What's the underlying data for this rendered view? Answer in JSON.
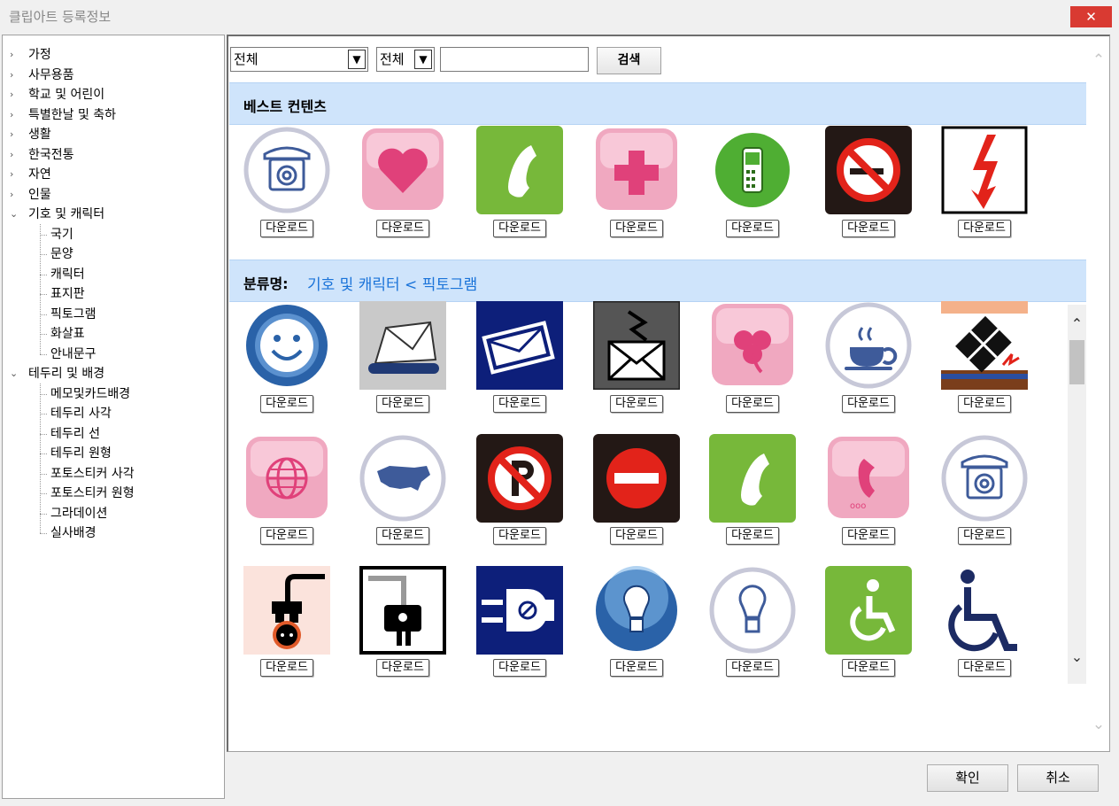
{
  "window": {
    "title": "클립아트 등록정보",
    "close_glyph": "✕"
  },
  "tree": {
    "categories": [
      {
        "label": "가정",
        "expanded": false
      },
      {
        "label": "사무용품",
        "expanded": false
      },
      {
        "label": "학교 및 어린이",
        "expanded": false
      },
      {
        "label": "특별한날 및 축하",
        "expanded": false
      },
      {
        "label": "생활",
        "expanded": false
      },
      {
        "label": "한국전통",
        "expanded": false
      },
      {
        "label": "자연",
        "expanded": false
      },
      {
        "label": "인물",
        "expanded": false
      },
      {
        "label": "기호 및 캐릭터",
        "expanded": true
      },
      {
        "label": "테두리 및 배경",
        "expanded": true
      }
    ],
    "symbols_children": [
      "국기",
      "문양",
      "캐릭터",
      "표지판",
      "픽토그램",
      "화살표",
      "안내문구"
    ],
    "border_children": [
      "메모및카드배경",
      "테두리 사각",
      "테두리 선",
      "테두리 원형",
      "포토스티커 사각",
      "포토스티커 원형",
      "그라데이션",
      "실사배경"
    ]
  },
  "toolbar": {
    "filter1": "전체",
    "filter2": "전체",
    "search_value": "",
    "search_label": "검색"
  },
  "best": {
    "title": "베스트 컨텐츠",
    "icons": [
      "telephone-circle-icon",
      "heart-icon",
      "phone-handset-icon",
      "cross-icon",
      "mobile-phone-icon",
      "no-smoking-icon",
      "high-voltage-icon"
    ]
  },
  "category": {
    "label": "분류명:",
    "path": "기호 및 캐릭터 < 픽토그램",
    "rows": [
      [
        "smiley-icon",
        "envelope-tray-icon",
        "mail-icon",
        "mail-lightning-icon",
        "clover-icon",
        "coffee-cup-icon",
        "fragile-box-icon"
      ],
      [
        "globe-icon",
        "usa-map-icon",
        "no-parking-icon",
        "no-entry-icon",
        "phone-handset-icon",
        "phone-receiver-icon",
        "telephone-circle-icon"
      ],
      [
        "power-plug-icon",
        "plug-icon",
        "plug-connector-icon",
        "light-bulb-icon",
        "light-bulb-outline-icon",
        "wheelchair-green-icon",
        "wheelchair-icon"
      ]
    ]
  },
  "download_label": "다운로드",
  "buttons": {
    "ok": "확인",
    "cancel": "취소"
  },
  "colors": {
    "band": "#cfe4fb",
    "path": "#1a73d9",
    "close": "#d93a32",
    "green": "#77b83a",
    "pink": "#f0a8c0"
  }
}
